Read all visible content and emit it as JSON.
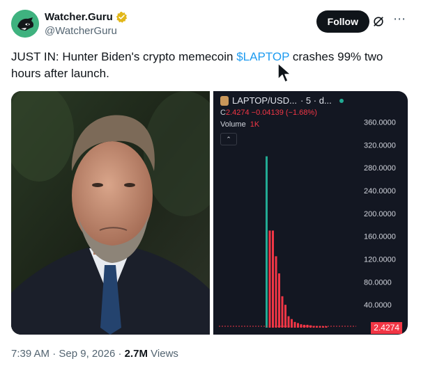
{
  "author": {
    "display_name": "Watcher.Guru",
    "handle": "@WatcherGuru",
    "verified_badge": "gold-check-badge",
    "avatar_icon": "dog-head-icon"
  },
  "actions": {
    "follow_label": "Follow",
    "grok_icon": "grok-icon",
    "more_icon": "more-icon"
  },
  "tweet": {
    "text_before": "JUST IN: Hunter Biden's crypto memecoin ",
    "cashtag": "$LAPTOP",
    "text_after": " crashes 99% two hours after launch."
  },
  "chart_card": {
    "title": "LAPTOP/USD...",
    "title_suffix": "· 5 · d...",
    "ohlc_prefix": "C",
    "ohlc_close": "2.4274",
    "ohlc_change": "−0.04139 (−1.68%)",
    "volume_label": "Volume",
    "volume_value": "1K",
    "collapse_icon": "chevron-up-icon",
    "last_price": "2.4274"
  },
  "chart_data": {
    "type": "bar",
    "title": "",
    "ylim": [
      0,
      380
    ],
    "y_ticks": [
      "360.0000",
      "320.0000",
      "280.0000",
      "240.0000",
      "200.0000",
      "160.0000",
      "120.0000",
      "80.0000",
      "40.0000"
    ],
    "y_tick_values": [
      360,
      320,
      280,
      240,
      200,
      160,
      120,
      80,
      40
    ],
    "series": [
      {
        "values": [
          300,
          170,
          170,
          125,
          95,
          55,
          40,
          20,
          15,
          10,
          8,
          6,
          5,
          5,
          4,
          3,
          3,
          3,
          2.5,
          2.5
        ]
      }
    ],
    "colors": {
      "down": "#f23645",
      "up": "#22ab94",
      "background": "#131722"
    }
  },
  "footer": {
    "time": "7:39 AM",
    "date": "Sep 9, 2026",
    "views_count": "2.7M",
    "views_label": "Views"
  }
}
